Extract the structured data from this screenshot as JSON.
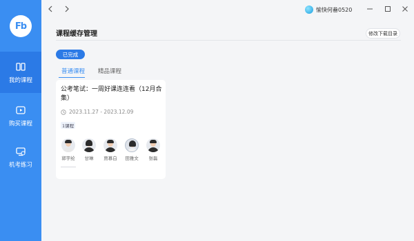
{
  "sidebar": {
    "logo_text": "Fb",
    "items": [
      {
        "label": "我的课程",
        "icon": "book-icon",
        "active": true
      },
      {
        "label": "购买课程",
        "icon": "video-play-icon",
        "active": false
      },
      {
        "label": "机考练习",
        "icon": "computer-exam-icon",
        "active": false
      }
    ]
  },
  "titlebar": {
    "username": "愉快何畚0520",
    "controls": [
      "minimize",
      "maximize",
      "close"
    ]
  },
  "header": {
    "title": "课程缓存管理",
    "edit_button": "修改下载目录"
  },
  "status_filter": "已完成",
  "tabs": [
    {
      "label": "普通课程",
      "active": true
    },
    {
      "label": "精品课程",
      "active": false
    }
  ],
  "course_card": {
    "title": "公考笔试：一周好课连连看（12月合集）",
    "date_range": "2023.11.27 - 2023.12.09",
    "course_count": "1课程",
    "teachers": [
      "郭宇纶",
      "甘琳",
      "贾慕白",
      "田雅文",
      "张磊"
    ]
  },
  "colors": {
    "accent": "#3a8ef2",
    "sidebar_active": "#2b7ae6",
    "background": "#f4f5f7"
  }
}
